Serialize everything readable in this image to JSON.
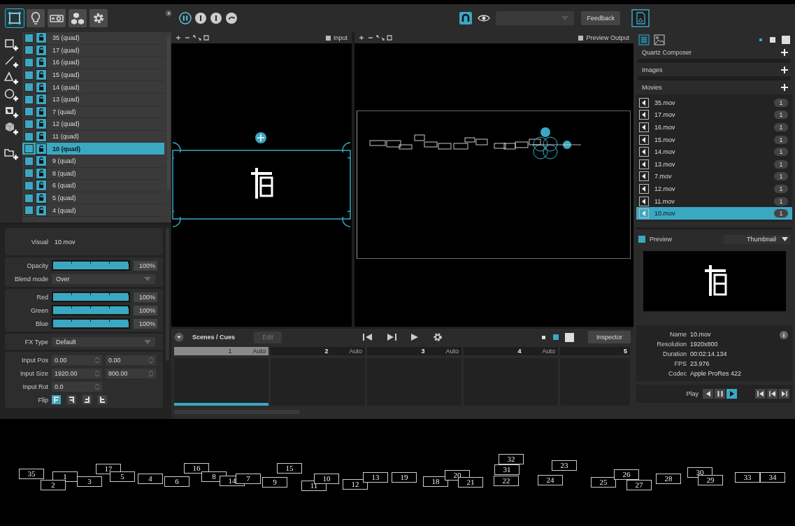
{
  "toolbar": {
    "modes": [
      {
        "selected": true
      },
      {
        "selected": false
      },
      {
        "selected": false
      },
      {
        "selected": false
      },
      {
        "selected": false
      }
    ],
    "feedback": "Feedback"
  },
  "layers": [
    {
      "label": "35 (quad)",
      "visible": true,
      "selected": false
    },
    {
      "label": "17 (quad)",
      "visible": true,
      "selected": false
    },
    {
      "label": "16 (quad)",
      "visible": true,
      "selected": false
    },
    {
      "label": "15 (quad)",
      "visible": true,
      "selected": false
    },
    {
      "label": "14 (quad)",
      "visible": true,
      "selected": false
    },
    {
      "label": "13 (quad)",
      "visible": true,
      "selected": false
    },
    {
      "label": "7 (quad)",
      "visible": true,
      "selected": false
    },
    {
      "label": "12 (quad)",
      "visible": true,
      "selected": false
    },
    {
      "label": "11 (quad)",
      "visible": true,
      "selected": false
    },
    {
      "label": "10 (quad)",
      "visible": false,
      "selected": true
    },
    {
      "label": "9 (quad)",
      "visible": true,
      "selected": false
    },
    {
      "label": "8 (quad)",
      "visible": true,
      "selected": false
    },
    {
      "label": "6 (quad)",
      "visible": true,
      "selected": false
    },
    {
      "label": "5 (quad)",
      "visible": true,
      "selected": false
    },
    {
      "label": "4 (quad)",
      "visible": true,
      "selected": false
    }
  ],
  "properties": {
    "visual": {
      "label": "Visual",
      "value": "10.mov"
    },
    "opacity": {
      "label": "Opacity",
      "level": 1,
      "reading": "100%"
    },
    "blend_mode": {
      "label": "Blend mode",
      "value": "Over"
    },
    "colors": [
      {
        "label": "Red",
        "level": 1,
        "reading": "100%"
      },
      {
        "label": "Green",
        "level": 1,
        "reading": "100%"
      },
      {
        "label": "Blue",
        "level": 1,
        "reading": "100%"
      }
    ],
    "fx_type": {
      "label": "FX Type",
      "value": "Default"
    },
    "inputs": [
      {
        "label": "Input Pos",
        "values": [
          "0.00",
          "0.00"
        ]
      },
      {
        "label": "Input Size",
        "values": [
          "1920.00",
          "800.00"
        ]
      },
      {
        "label": "Input Rot",
        "values": [
          "0.0"
        ]
      }
    ],
    "flip": {
      "label": "Flip",
      "buttons": [
        {
          "kind": "normal",
          "selected": true
        },
        {
          "kind": "mirror",
          "selected": false
        },
        {
          "kind": "rotate",
          "selected": false
        },
        {
          "kind": "flip",
          "selected": false
        }
      ]
    }
  },
  "viewports": [
    {
      "title": "Input",
      "checked": false
    },
    {
      "title": "Preview Output",
      "checked": false
    }
  ],
  "scenes": {
    "title": "Scenes / Cues",
    "edit": "Edit",
    "edit_disabled": true,
    "inspector": "Inspector",
    "cues": [
      {
        "number": "1",
        "mode": "Auto",
        "selected": true
      },
      {
        "number": "2",
        "mode": "Auto",
        "selected": false
      },
      {
        "number": "3",
        "mode": "Auto",
        "selected": false
      },
      {
        "number": "4",
        "mode": "Auto",
        "selected": false
      },
      {
        "number": "5",
        "selected": false
      }
    ]
  },
  "sources": {
    "categories": [
      {
        "name": "Quartz Composer"
      },
      {
        "name": "Images"
      },
      {
        "name": "Movies"
      }
    ],
    "movies": [
      {
        "name": "35.mov",
        "count": "1",
        "selected": false
      },
      {
        "name": "17.mov",
        "count": "1",
        "selected": false
      },
      {
        "name": "16.mov",
        "count": "1",
        "selected": false
      },
      {
        "name": "15.mov",
        "count": "1",
        "selected": false
      },
      {
        "name": "14.mov",
        "count": "1",
        "selected": false
      },
      {
        "name": "13.mov",
        "count": "1",
        "selected": false
      },
      {
        "name": "7.mov",
        "count": "1",
        "selected": false
      },
      {
        "name": "12.mov",
        "count": "1",
        "selected": false
      },
      {
        "name": "11.mov",
        "count": "1",
        "selected": false
      },
      {
        "name": "10.mov",
        "count": "1",
        "selected": true
      }
    ]
  },
  "preview": {
    "label": "Preview",
    "checked": true,
    "mode": "Thumbnail"
  },
  "info": [
    {
      "label": "Name",
      "value": "10.mov"
    },
    {
      "label": "Resolution",
      "value": "1920x800"
    },
    {
      "label": "Duration",
      "value": "00:02:14.134"
    },
    {
      "label": "FPS",
      "value": "23.976"
    },
    {
      "label": "Codec",
      "value": "Apple ProRes 422"
    }
  ],
  "playback": {
    "label": "Play",
    "playing": true
  },
  "output_canvas": {
    "labels": [
      "35",
      "1",
      "2",
      "3",
      "17",
      "5",
      "4",
      "6",
      "16",
      "8",
      "14",
      "7",
      "9",
      "15",
      "11",
      "10",
      "12",
      "13",
      "19",
      "18",
      "20",
      "21",
      "32",
      "31",
      "22",
      "23",
      "24",
      "25",
      "26",
      "27",
      "28",
      "30",
      "29",
      "33",
      "34"
    ]
  }
}
